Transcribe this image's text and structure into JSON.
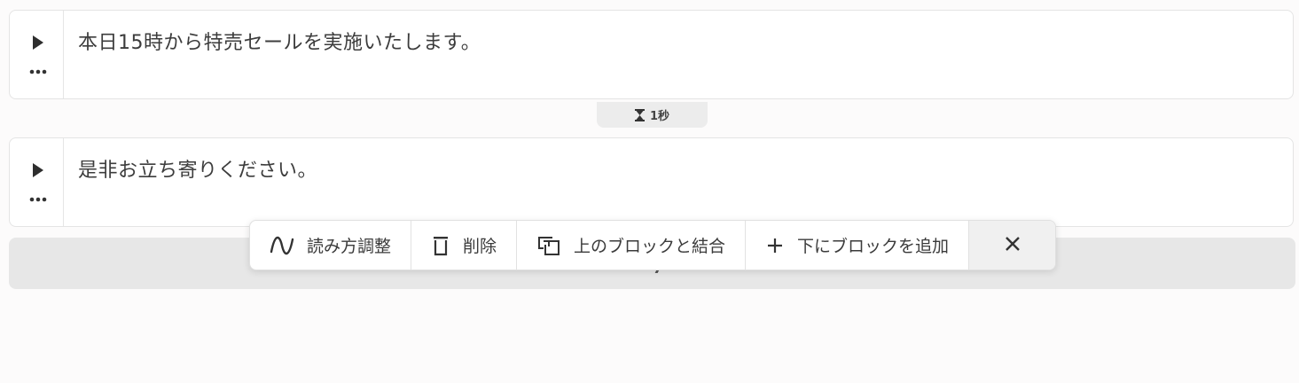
{
  "blocks": [
    {
      "text": "本日15時から特売セールを実施いたします。",
      "play_icon": "play-icon",
      "menu_icon": "more-horizontal-icon"
    },
    {
      "text": "是非お立ち寄りください。",
      "play_icon": "play-icon",
      "menu_icon": "more-horizontal-icon"
    }
  ],
  "pause": {
    "icon": "hourglass-icon",
    "label": "1秒"
  },
  "toolbar": {
    "reading_label": "読み方調整",
    "reading_icon": "wave-icon",
    "delete_label": "削除",
    "delete_icon": "trash-icon",
    "merge_label": "上のブロックと結合",
    "merge_icon": "merge-icon",
    "add_label": "下にブロックを追加",
    "add_icon": "plus-icon",
    "close_icon": "close-icon"
  },
  "colors": {
    "background": "#fcfbfb",
    "block_border": "#e4e4e4",
    "pause_bg": "#ececec",
    "add_bar_bg": "#e7e7e7",
    "text": "#3c3c3c"
  }
}
